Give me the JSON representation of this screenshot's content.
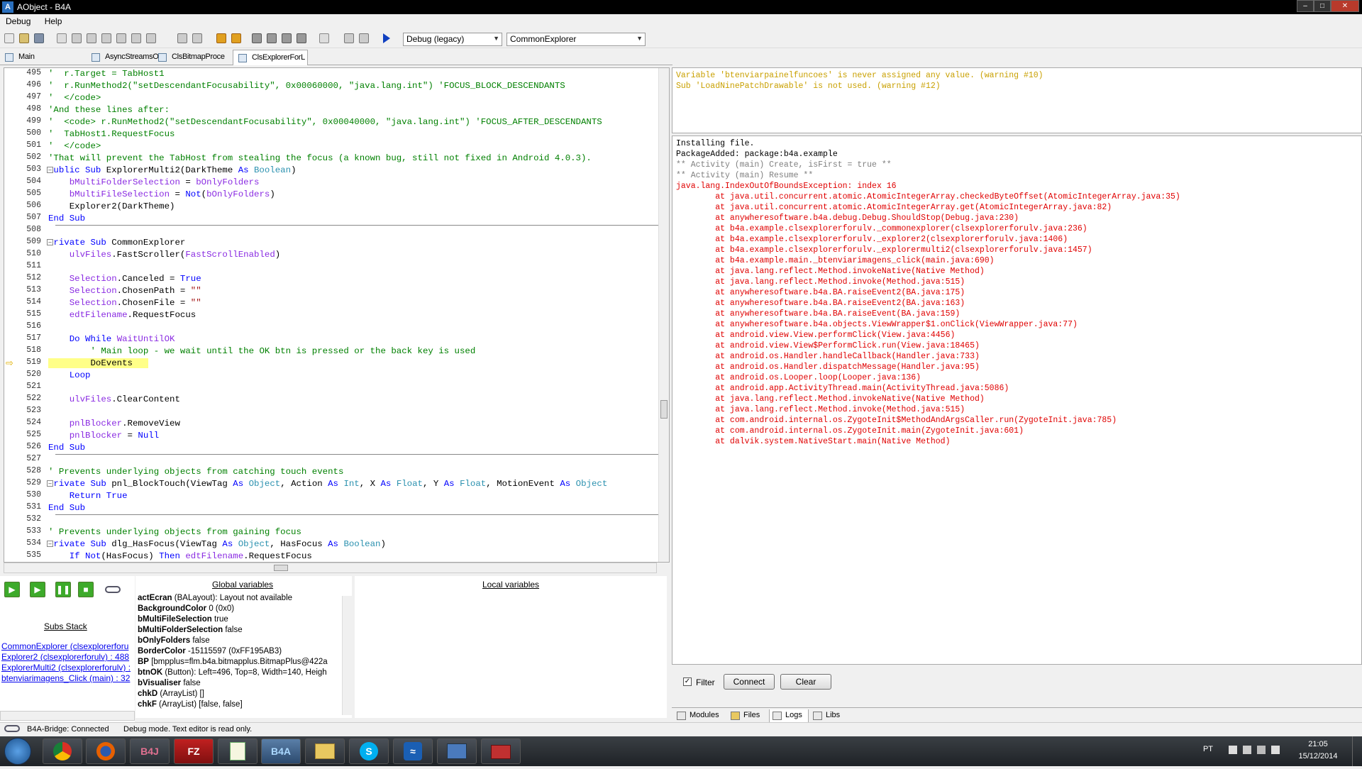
{
  "window": {
    "title": "AObject - B4A"
  },
  "menu": [
    "Debug",
    "Help"
  ],
  "toolbar": {
    "build_config": "Debug (legacy)",
    "sub_selector": "CommonExplorer"
  },
  "tabs": [
    {
      "label": "Main"
    },
    {
      "label": "AsyncStreamsO"
    },
    {
      "label": "ClsBitmapProce"
    },
    {
      "label": "ClsExplorerForL"
    }
  ],
  "code": [
    {
      "n": "495",
      "html": "<span class='cm'>'  r.Target = TabHost1</span>"
    },
    {
      "n": "496",
      "html": "<span class='cm'>'  r.RunMethod2(\"setDescendantFocusability\", 0x00060000, \"java.lang.int\") 'FOCUS_BLOCK_DESCENDANTS</span>"
    },
    {
      "n": "497",
      "html": "<span class='cm'>'  &lt;/code&gt;</span>"
    },
    {
      "n": "498",
      "html": "<span class='cm'>'And these lines after:</span>"
    },
    {
      "n": "499",
      "html": "<span class='cm'>'  &lt;code&gt; r.RunMethod2(\"setDescendantFocusability\", 0x00040000, \"java.lang.int\") 'FOCUS_AFTER_DESCENDANTS</span>"
    },
    {
      "n": "500",
      "html": "<span class='cm'>'  TabHost1.RequestFocus</span>"
    },
    {
      "n": "501",
      "html": "<span class='cm'>'  &lt;/code&gt;</span>"
    },
    {
      "n": "502",
      "html": "<span class='cm'>'That will prevent the TabHost from stealing the focus (a known bug, still not fixed in Android 4.0.3).</span>"
    },
    {
      "n": "503",
      "html": "<span class='kw'>Public Sub</span> ExplorerMulti2(DarkTheme <span class='kw'>As</span> <span class='ty'>Boolean</span>)"
    },
    {
      "n": "504",
      "html": "    <span class='id'>bMultiFolderSelection</span> = <span class='id'>bOnlyFolders</span>"
    },
    {
      "n": "505",
      "html": "    <span class='id'>bMultiFileSelection</span> = <span class='kw'>Not</span>(<span class='id'>bOnlyFolders</span>)"
    },
    {
      "n": "506",
      "html": "    Explorer2(DarkTheme)"
    },
    {
      "n": "507",
      "html": "<span class='kw'>End Sub</span>"
    },
    {
      "n": "508",
      "html": ""
    },
    {
      "n": "509",
      "html": "<span class='kw'>Private Sub</span> CommonExplorer"
    },
    {
      "n": "510",
      "html": "    <span class='id'>ulvFiles</span>.FastScroller(<span class='id'>FastScrollEnabled</span>)"
    },
    {
      "n": "511",
      "html": ""
    },
    {
      "n": "512",
      "html": "    <span class='id'>Selection</span>.Canceled = <span class='kw'>True</span>"
    },
    {
      "n": "513",
      "html": "    <span class='id'>Selection</span>.ChosenPath = <span class='st'>\"\"</span>"
    },
    {
      "n": "514",
      "html": "    <span class='id'>Selection</span>.ChosenFile = <span class='st'>\"\"</span>"
    },
    {
      "n": "515",
      "html": "    <span class='id'>edtFilename</span>.RequestFocus"
    },
    {
      "n": "516",
      "html": ""
    },
    {
      "n": "517",
      "html": "    <span class='kw'>Do While</span> <span class='id'>WaitUntilOK</span>"
    },
    {
      "n": "518",
      "html": "        <span class='cm'>' Main loop - we wait until the OK btn is pressed or the back key is used</span>"
    },
    {
      "n": "519",
      "html": "<span class='hl'>        DoEvents   </span>"
    },
    {
      "n": "520",
      "html": "    <span class='kw'>Loop</span>"
    },
    {
      "n": "521",
      "html": ""
    },
    {
      "n": "522",
      "html": "    <span class='id'>ulvFiles</span>.ClearContent"
    },
    {
      "n": "523",
      "html": ""
    },
    {
      "n": "524",
      "html": "    <span class='id'>pnlBlocker</span>.RemoveView"
    },
    {
      "n": "525",
      "html": "    <span class='id'>pnlBlocker</span> = <span class='kw'>Null</span>"
    },
    {
      "n": "526",
      "html": "<span class='kw'>End Sub</span>"
    },
    {
      "n": "527",
      "html": ""
    },
    {
      "n": "528",
      "html": "<span class='cm'>' Prevents underlying objects from catching touch events</span>"
    },
    {
      "n": "529",
      "html": "<span class='kw'>Private Sub</span> pnl_BlockTouch(ViewTag <span class='kw'>As</span> <span class='ty'>Object</span>, Action <span class='kw'>As</span> <span class='ty'>Int</span>, X <span class='kw'>As</span> <span class='ty'>Float</span>, Y <span class='kw'>As</span> <span class='ty'>Float</span>, MotionEvent <span class='kw'>As</span> <span class='ty'>Object</span>"
    },
    {
      "n": "530",
      "html": "    <span class='kw'>Return True</span>"
    },
    {
      "n": "531",
      "html": "<span class='kw'>End Sub</span>"
    },
    {
      "n": "532",
      "html": ""
    },
    {
      "n": "533",
      "html": "<span class='cm'>' Prevents underlying objects from gaining focus</span>"
    },
    {
      "n": "534",
      "html": "<span class='kw'>Private Sub</span> dlg_HasFocus(ViewTag <span class='kw'>As</span> <span class='ty'>Object</span>, HasFocus <span class='kw'>As</span> <span class='ty'>Boolean</span>)"
    },
    {
      "n": "535",
      "html": "    <span class='kw'>If Not</span>(HasFocus) <span class='kw'>Then</span> <span class='id'>edtFilename</span>.RequestFocus"
    }
  ],
  "warnings": [
    "Variable 'btenviarpainelfuncoes' is never assigned any value. (warning #10)",
    "Sub 'LoadNinePatchDrawable' is not used. (warning #12)"
  ],
  "logs": [
    {
      "c": "black",
      "t": "Installing file."
    },
    {
      "c": "black",
      "t": "PackageAdded: package:b4a.example"
    },
    {
      "c": "gray",
      "t": "** Activity (main) Create, isFirst = true **"
    },
    {
      "c": "gray",
      "t": "** Activity (main) Resume **"
    },
    {
      "c": "red",
      "t": "java.lang.IndexOutOfBoundsException: index 16"
    },
    {
      "c": "red",
      "t": "\tat java.util.concurrent.atomic.AtomicIntegerArray.checkedByteOffset(AtomicIntegerArray.java:35)"
    },
    {
      "c": "red",
      "t": "\tat java.util.concurrent.atomic.AtomicIntegerArray.get(AtomicIntegerArray.java:82)"
    },
    {
      "c": "red",
      "t": "\tat anywheresoftware.b4a.debug.Debug.ShouldStop(Debug.java:230)"
    },
    {
      "c": "red",
      "t": "\tat b4a.example.clsexplorerforulv._commonexplorer(clsexplorerforulv.java:236)"
    },
    {
      "c": "red",
      "t": "\tat b4a.example.clsexplorerforulv._explorer2(clsexplorerforulv.java:1406)"
    },
    {
      "c": "red",
      "t": "\tat b4a.example.clsexplorerforulv._explorermulti2(clsexplorerforulv.java:1457)"
    },
    {
      "c": "red",
      "t": "\tat b4a.example.main._btenviarimagens_click(main.java:690)"
    },
    {
      "c": "red",
      "t": "\tat java.lang.reflect.Method.invokeNative(Native Method)"
    },
    {
      "c": "red",
      "t": "\tat java.lang.reflect.Method.invoke(Method.java:515)"
    },
    {
      "c": "red",
      "t": "\tat anywheresoftware.b4a.BA.raiseEvent2(BA.java:175)"
    },
    {
      "c": "red",
      "t": "\tat anywheresoftware.b4a.BA.raiseEvent2(BA.java:163)"
    },
    {
      "c": "red",
      "t": "\tat anywheresoftware.b4a.BA.raiseEvent(BA.java:159)"
    },
    {
      "c": "red",
      "t": "\tat anywheresoftware.b4a.objects.ViewWrapper$1.onClick(ViewWrapper.java:77)"
    },
    {
      "c": "red",
      "t": "\tat android.view.View.performClick(View.java:4456)"
    },
    {
      "c": "red",
      "t": "\tat android.view.View$PerformClick.run(View.java:18465)"
    },
    {
      "c": "red",
      "t": "\tat android.os.Handler.handleCallback(Handler.java:733)"
    },
    {
      "c": "red",
      "t": "\tat android.os.Handler.dispatchMessage(Handler.java:95)"
    },
    {
      "c": "red",
      "t": "\tat android.os.Looper.loop(Looper.java:136)"
    },
    {
      "c": "red",
      "t": "\tat android.app.ActivityThread.main(ActivityThread.java:5086)"
    },
    {
      "c": "red",
      "t": "\tat java.lang.reflect.Method.invokeNative(Native Method)"
    },
    {
      "c": "red",
      "t": "\tat java.lang.reflect.Method.invoke(Method.java:515)"
    },
    {
      "c": "red",
      "t": "\tat com.android.internal.os.ZygoteInit$MethodAndArgsCaller.run(ZygoteInit.java:785)"
    },
    {
      "c": "red",
      "t": "\tat com.android.internal.os.ZygoteInit.main(ZygoteInit.java:601)"
    },
    {
      "c": "red",
      "t": "\tat dalvik.system.NativeStart.main(Native Method)"
    }
  ],
  "logctl": {
    "filter": "Filter",
    "connect": "Connect",
    "clear": "Clear"
  },
  "panel_tabs": [
    "Modules",
    "Files",
    "Logs",
    "Libs"
  ],
  "debug": {
    "subs_stack_title": "Subs Stack",
    "subs_stack": [
      "CommonExplorer (clsexplorerforu",
      "Explorer2 (clsexplorerforulv) : 488",
      "ExplorerMulti2 (clsexplorerforulv) :",
      "btenviarimagens_Click (main) : 32"
    ],
    "global_title": "Global variables",
    "local_title": "Local variables",
    "globals": [
      {
        "name": "actEcran",
        "value": "(BALayout): Layout not available"
      },
      {
        "name": "BackgroundColor",
        "value": "0 (0x0)"
      },
      {
        "name": "bMultiFileSelection",
        "value": "true"
      },
      {
        "name": "bMultiFolderSelection",
        "value": "false"
      },
      {
        "name": "bOnlyFolders",
        "value": "false"
      },
      {
        "name": "BorderColor",
        "value": "-15115597 (0xFF195AB3)"
      },
      {
        "name": "BP",
        "value": "[bmpplus=flm.b4a.bitmapplus.BitmapPlus@422a"
      },
      {
        "name": "btnOK",
        "value": "(Button): Left=496, Top=8, Width=140, Heigh"
      },
      {
        "name": "bVisualiser",
        "value": "false"
      },
      {
        "name": "chkD",
        "value": "(ArrayList) []"
      },
      {
        "name": "chkF",
        "value": "(ArrayList) [false, false]"
      }
    ]
  },
  "status": {
    "bridge": "B4A-Bridge: Connected",
    "mode": "Debug mode. Text editor is read only."
  },
  "taskbar": {
    "items": [
      "Chrome",
      "Firefox",
      "B4J",
      "FileZilla",
      "Notepad++",
      "B4A",
      "Explorer",
      "Skype",
      "Connectify",
      "Remote",
      "Toolbox"
    ]
  },
  "tray": {
    "lang": "PT",
    "time": "21:05",
    "date": "15/12/2014"
  }
}
